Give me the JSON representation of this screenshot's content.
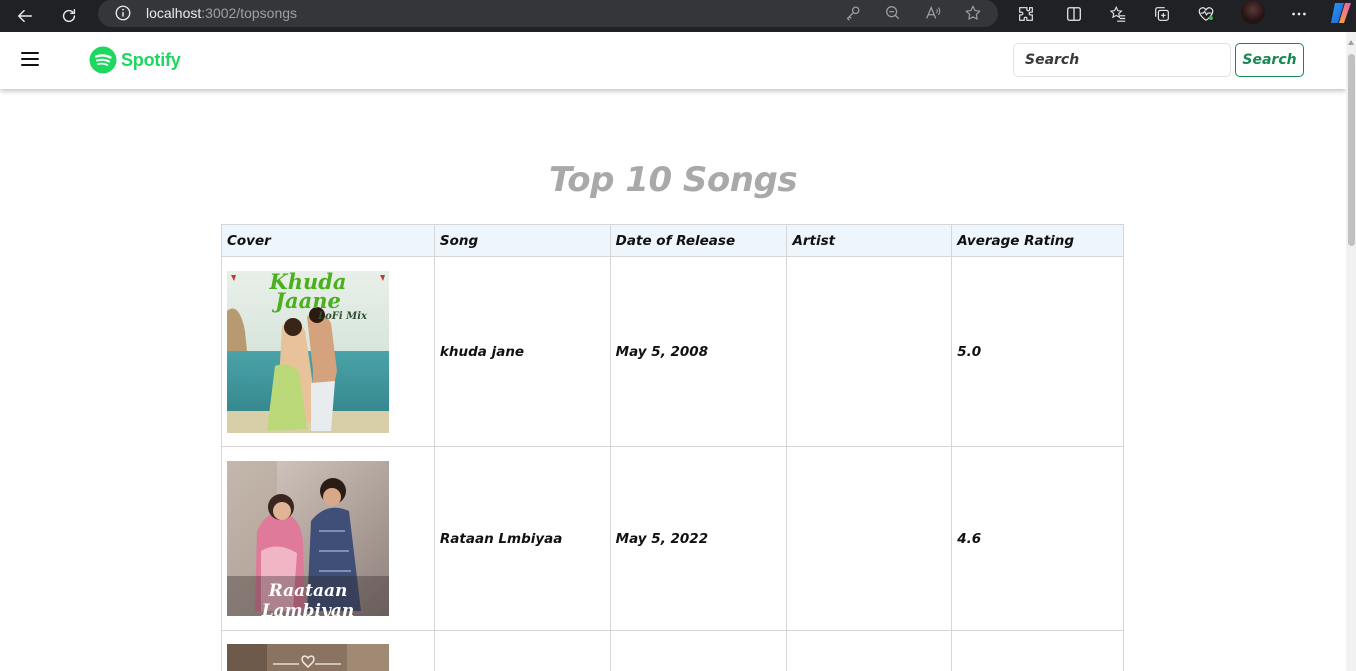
{
  "browser": {
    "url_host": "localhost",
    "url_rest": ":3002/topsongs"
  },
  "navbar": {
    "brand": "Spotify",
    "search_placeholder": "Search",
    "search_button": "Search"
  },
  "page": {
    "title": "Top 10 Songs"
  },
  "table": {
    "headers": [
      "Cover",
      "Song",
      "Date of Release",
      "Artist",
      "Average Rating"
    ],
    "rows": [
      {
        "cover_text": "Khuda Jaane",
        "cover_subtext": "LoFi Mix",
        "song": "khuda jane",
        "date": "May 5, 2008",
        "artist": "",
        "rating": "5.0"
      },
      {
        "cover_text": "Raataan Lambiyan",
        "song": "Rataan Lmbiyaa",
        "date": "May 5, 2022",
        "artist": "",
        "rating": "4.6"
      },
      {
        "song": "",
        "date": "",
        "artist": "",
        "rating": ""
      }
    ]
  },
  "colors": {
    "brand_green": "#1ed760",
    "button_green": "#198754",
    "title_gray": "#a9a9a9",
    "header_bg": "#eef6fd"
  },
  "icons": [
    "back-icon",
    "reload-icon",
    "info-icon",
    "key-icon",
    "zoom-out-icon",
    "read-aloud-icon",
    "favorite-star-icon",
    "extensions-icon",
    "split-screen-icon",
    "favorites-icon",
    "collections-icon",
    "browser-essentials-icon",
    "more-icon",
    "copilot-icon",
    "hamburger-icon",
    "spotify-logo-icon"
  ]
}
